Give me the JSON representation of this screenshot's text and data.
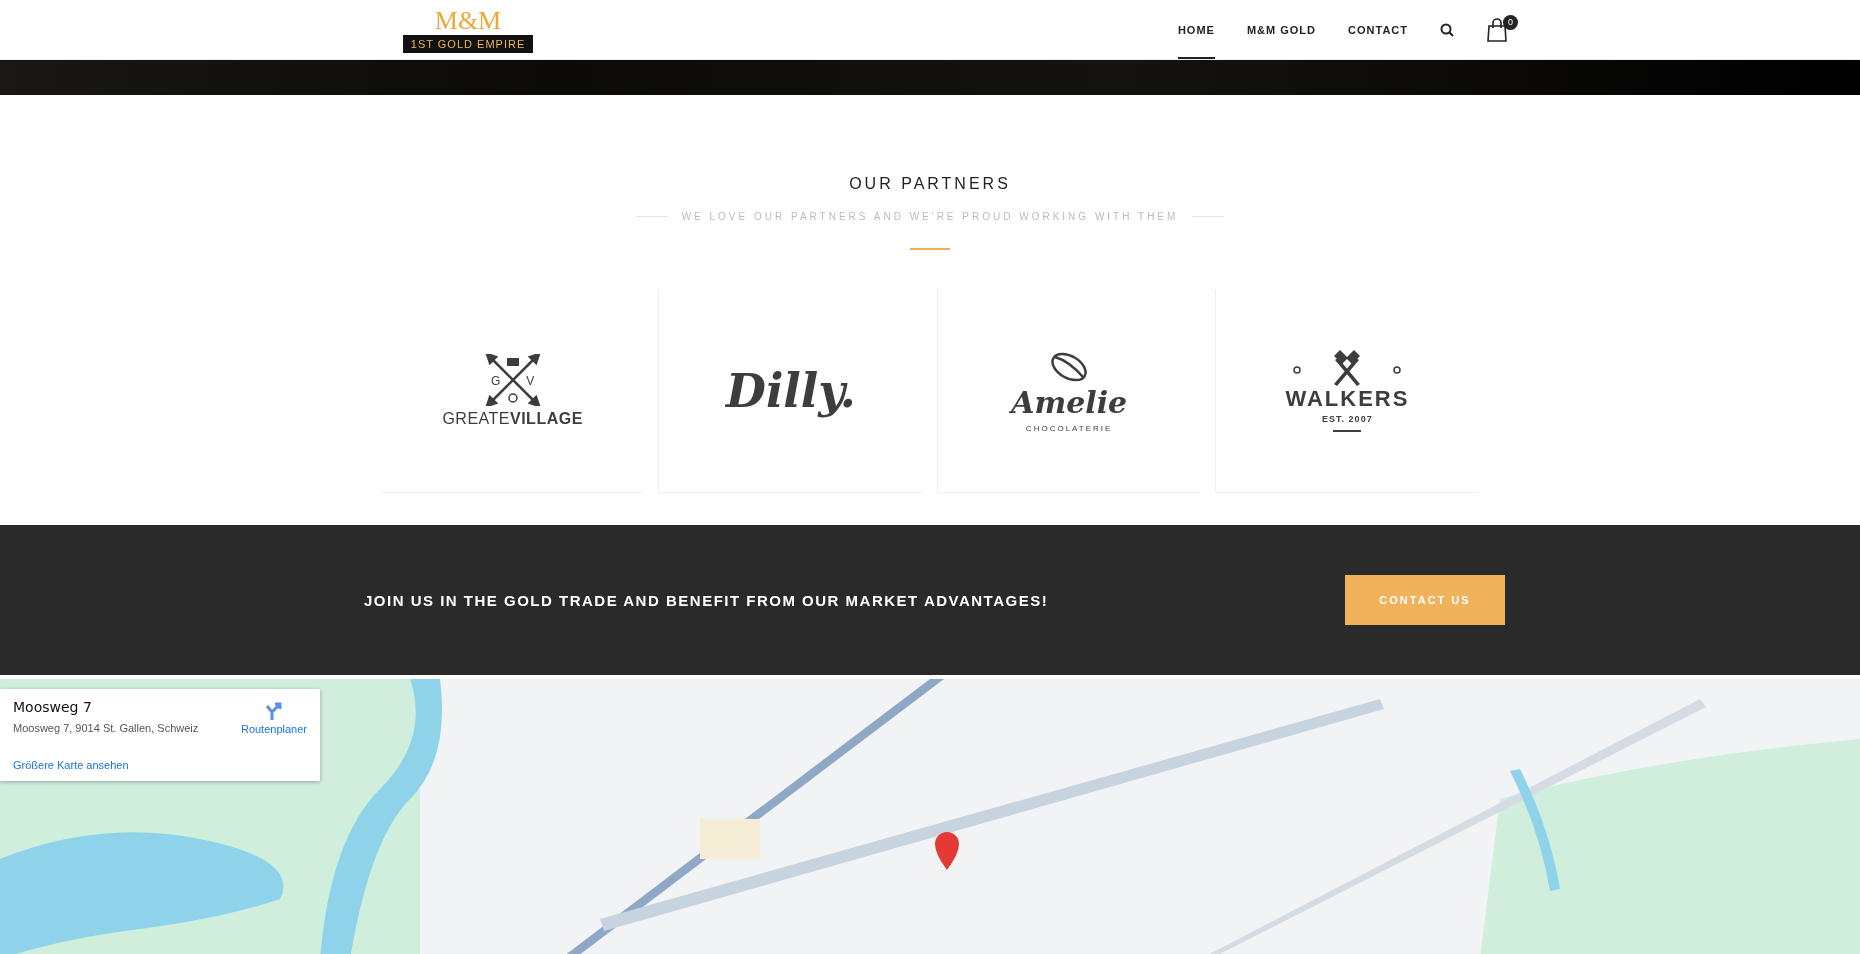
{
  "header": {
    "logo": {
      "monogram": "M&M",
      "tagline": "1ST GOLD EMPIRE"
    },
    "nav": [
      {
        "label": "HOME",
        "selected": true
      },
      {
        "label": "M&M GOLD",
        "selected": false
      },
      {
        "label": "CONTACT",
        "selected": false
      }
    ],
    "cart_count": "0"
  },
  "partners": {
    "title": "OUR PARTNERS",
    "subtitle": "WE LOVE OUR PARTNERS AND WE'RE PROUD WORKING WITH THEM",
    "logos": [
      {
        "kind": "arrows",
        "letters": [
          "G",
          "V"
        ],
        "name": "GREATE**VILLAGE**"
      },
      {
        "kind": "script",
        "name": "Dilly."
      },
      {
        "kind": "bean",
        "name": "Amelie",
        "sub": "CHOCOLATERIE"
      },
      {
        "kind": "axes",
        "name": "WALKERS",
        "sub": "EST. 2007"
      }
    ]
  },
  "cta": {
    "text": "JOIN US IN THE GOLD TRADE AND BENEFIT FROM OUR MARKET ADVANTAGES!",
    "button": "CONTACT US"
  },
  "map": {
    "kind": "picture",
    "card": {
      "title": "Moosweg 7",
      "address": "Moosweg 7, 9014 St. Gallen, Schweiz",
      "directions": "Routenplaner",
      "link": "Größere Karte ansehen"
    }
  }
}
